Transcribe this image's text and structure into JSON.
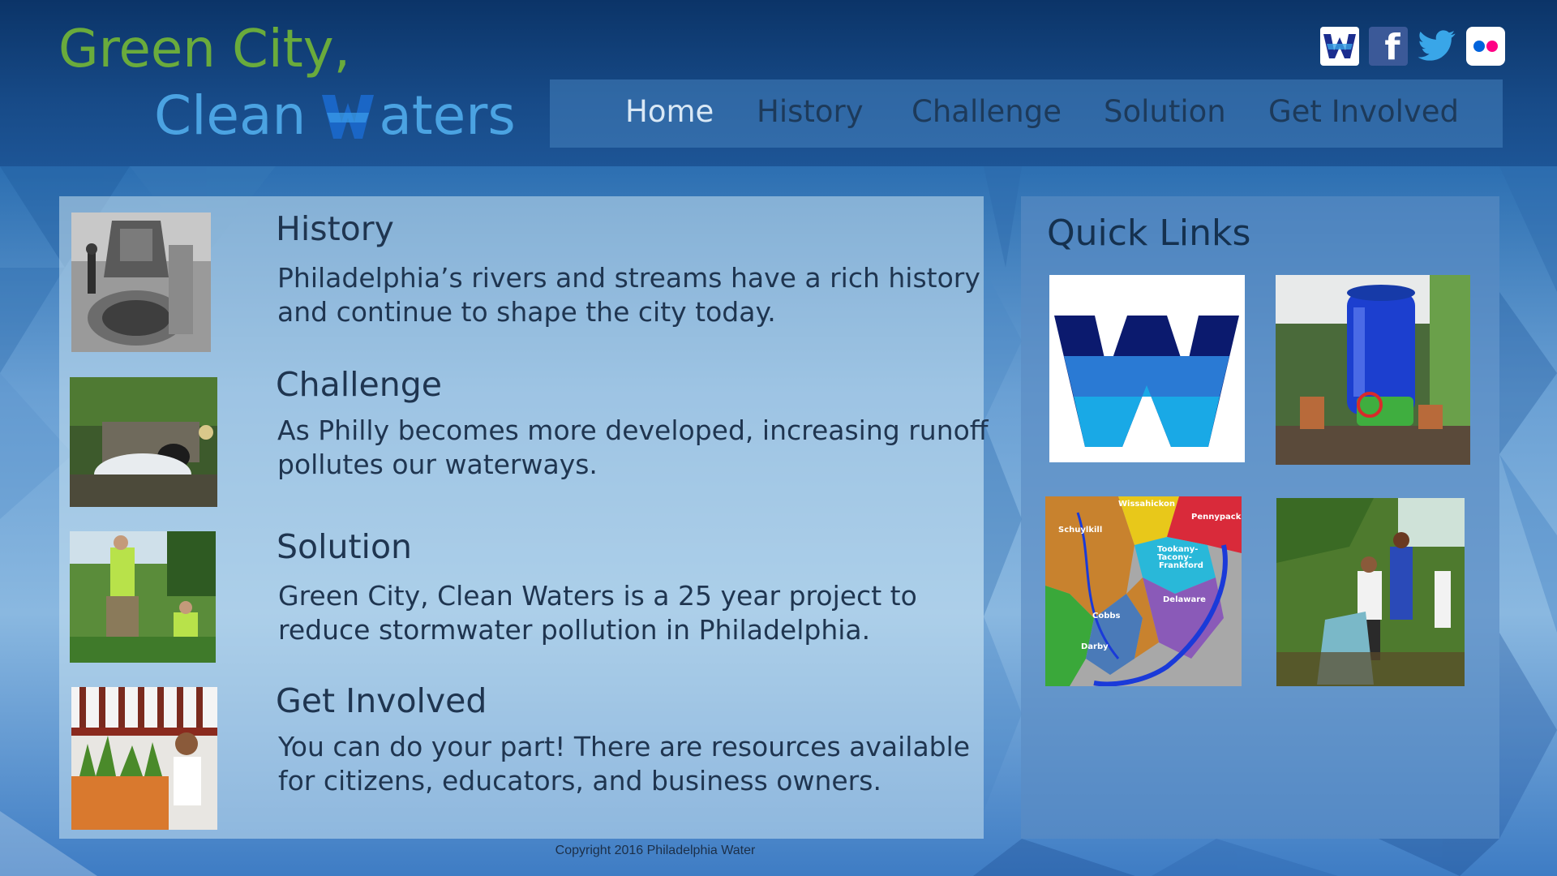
{
  "brand": {
    "line1": "Green City,",
    "line2_before": "Clean",
    "line2_after": "aters",
    "green": "#6aab3c",
    "blue": "#4ba3e2"
  },
  "social": [
    {
      "name": "PWD",
      "icon": "w-logo-icon"
    },
    {
      "name": "Facebook",
      "icon": "facebook-icon",
      "glyph": "f"
    },
    {
      "name": "Twitter",
      "icon": "twitter-icon"
    },
    {
      "name": "Flickr",
      "icon": "flickr-icon"
    }
  ],
  "nav": {
    "items": [
      {
        "label": "Home",
        "active": true
      },
      {
        "label": "History",
        "active": false
      },
      {
        "label": "Challenge",
        "active": false
      },
      {
        "label": "Solution",
        "active": false
      },
      {
        "label": "Get Involved",
        "active": false
      }
    ]
  },
  "topics": [
    {
      "title": "History",
      "description": "Philadelphia’s rivers and streams have a rich history and continue to shape the city today.",
      "image": "historic-sewer-construction-photo"
    },
    {
      "title": "Challenge",
      "description": "As Philly becomes more developed, increasing runoff pollutes our waterways.",
      "image": "stormwater-outfall-photo"
    },
    {
      "title": "Solution",
      "description": "Green City, Clean Waters is a 25 year project to reduce stormwater pollution in Philadelphia.",
      "image": "green-infrastructure-workers-photo"
    },
    {
      "title": "Get Involved",
      "description": "You can do your part! There are resources available for citizens, educators, and business owners.",
      "image": "planter-volunteer-photo"
    }
  ],
  "quick_links": {
    "title": "Quick Links",
    "tiles": [
      {
        "name": "pwd-logo-tile"
      },
      {
        "name": "rain-barrel-tile"
      },
      {
        "name": "watershed-map-tile",
        "map_labels": [
          "Wissahickon",
          "Pennypack",
          "Schuylkill",
          "Tookany-",
          "Tacony-",
          "Frankford",
          "Delaware",
          "Cobbs",
          "Darby"
        ]
      },
      {
        "name": "cleanup-volunteers-tile"
      }
    ]
  },
  "footer": {
    "copyright": "Copyright 2016 Philadelphia Water"
  }
}
